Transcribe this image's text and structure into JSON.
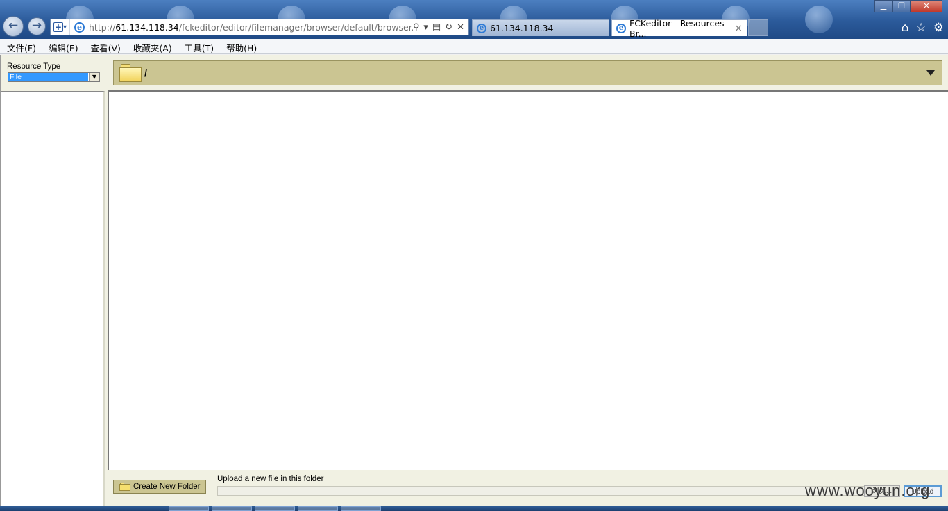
{
  "browser": {
    "address_url_prefix": "http://",
    "address_url_host": "61.134.118.34",
    "address_url_path": "/fckeditor/editor/filemanager/browser/default/browser.htm",
    "tabs": [
      {
        "label": "61.134.118.34"
      },
      {
        "label": "FCKeditor - Resources Br..."
      }
    ],
    "menu": [
      "文件(F)",
      "编辑(E)",
      "查看(V)",
      "收藏夹(A)",
      "工具(T)",
      "帮助(H)"
    ]
  },
  "file_browser": {
    "resource_type_label": "Resource Type",
    "resource_type_selected": "File",
    "current_path": "/",
    "create_folder_label": "Create New Folder",
    "upload_label": "Upload a new file in this folder",
    "browse_label": "浏览...",
    "upload_button_label": "Upload"
  },
  "watermark": "www.wooyun.org",
  "colors": {
    "panel_background": "#f1f1e3",
    "path_bar": "#cbc592",
    "selection": "#3399ff"
  }
}
